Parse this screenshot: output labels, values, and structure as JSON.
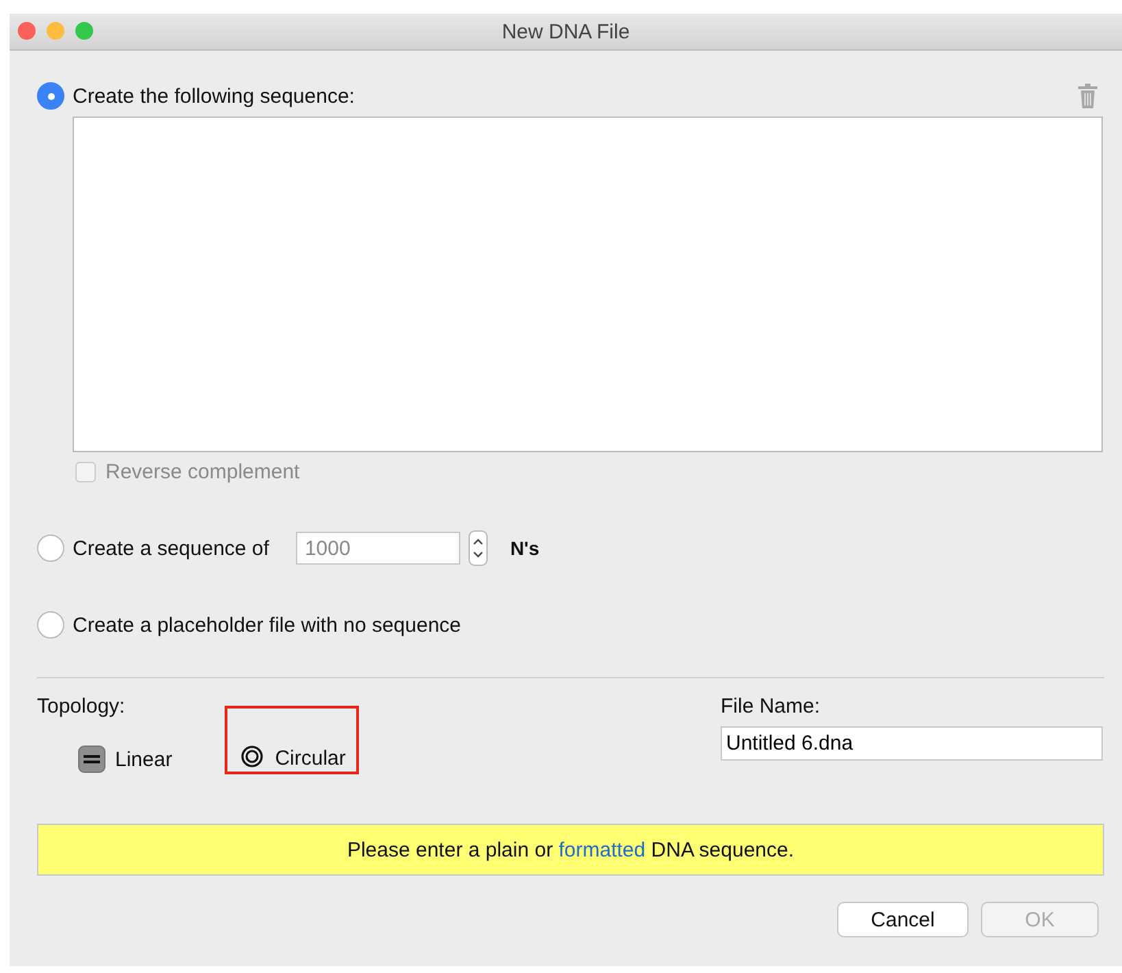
{
  "window": {
    "title": "New DNA File"
  },
  "options": [
    {
      "kind": "sequence",
      "label": "Create the following sequence:",
      "selected": true,
      "reverse_complement": {
        "label": "Reverse complement",
        "checked": false,
        "disabled": true
      }
    },
    {
      "kind": "count",
      "label": "Create a sequence of",
      "selected": false,
      "value": "1000",
      "unit": "N's"
    },
    {
      "kind": "plain",
      "label": "Create a placeholder file with no sequence",
      "selected": false
    }
  ],
  "topology": {
    "label": "Topology:",
    "options": [
      {
        "kind": "linear",
        "label": "Linear",
        "selected": true,
        "highlighted": false
      },
      {
        "kind": "circular",
        "label": "Circular",
        "selected": false,
        "highlighted": true
      }
    ]
  },
  "file_name": {
    "label": "File Name:",
    "value": "Untitled 6.dna"
  },
  "message": {
    "before": "Please enter a plain or",
    "link": "formatted",
    "after": "DNA sequence."
  },
  "buttons": [
    {
      "label": "Cancel",
      "disabled": false
    },
    {
      "label": "OK",
      "disabled": true
    }
  ]
}
